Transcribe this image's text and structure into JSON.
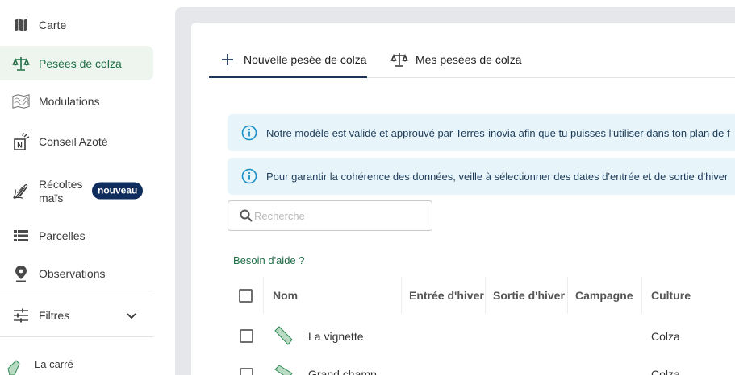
{
  "sidebar": {
    "items": [
      {
        "label": "Carte",
        "icon": "map-icon"
      },
      {
        "label": "Pesées de colza",
        "icon": "scale-icon",
        "active": true
      },
      {
        "label": "Modulations",
        "icon": "modulation-map-icon"
      },
      {
        "label": "Conseil Azoté",
        "icon": "nitrogen-icon"
      },
      {
        "label_line1": "Récoltes",
        "label_line2": "maïs",
        "icon": "corn-icon",
        "badge": "nouveau"
      },
      {
        "label": "Parcelles",
        "icon": "list-icon"
      },
      {
        "label": "Observations",
        "icon": "pin-icon"
      }
    ],
    "filters_label": "Filtres",
    "parcel_preview_label": "La carré"
  },
  "tabs": [
    {
      "label": "Nouvelle pesée de colza",
      "icon": "plus-icon",
      "active": true
    },
    {
      "label": "Mes pesées de colza",
      "icon": "scale-icon"
    }
  ],
  "alerts": [
    {
      "text": "Notre modèle est validé et approuvé par Terres-inovia afin que tu puisses l'utiliser dans ton plan de f"
    },
    {
      "text": "Pour garantir la cohérence des données, veille à sélectionner des dates d'entrée et de sortie d'hiver"
    }
  ],
  "search": {
    "placeholder": "Recherche"
  },
  "help_link": "Besoin d'aide ?",
  "table": {
    "headers": [
      "Nom",
      "Entrée d'hiver",
      "Sortie d'hiver",
      "Campagne",
      "Culture"
    ],
    "rows": [
      {
        "name": "La vignette",
        "culture": "Colza"
      },
      {
        "name": "Grand champ",
        "culture": "Colza"
      }
    ]
  },
  "colors": {
    "accent_green": "#1f6e45",
    "active_bg": "#eef5ef",
    "navy": "#0f2d5c",
    "info_bg": "#e7f4fa",
    "info_icon": "#1a8fc4",
    "plot_fill": "#b9dbc3"
  }
}
